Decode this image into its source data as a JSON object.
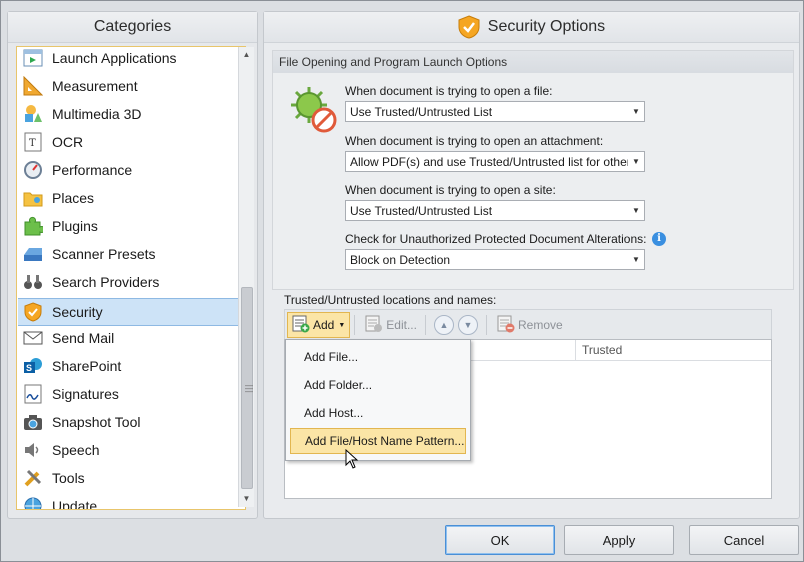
{
  "left_panel": {
    "title": "Categories",
    "items": [
      {
        "label": "Launch Applications",
        "icon": "launch-app-icon"
      },
      {
        "label": "Measurement",
        "icon": "ruler-icon"
      },
      {
        "label": "Multimedia 3D",
        "icon": "shapes-3d-icon"
      },
      {
        "label": "OCR",
        "icon": "ocr-icon"
      },
      {
        "label": "Performance",
        "icon": "gauge-icon"
      },
      {
        "label": "Places",
        "icon": "folder-icon"
      },
      {
        "label": "Plugins",
        "icon": "puzzle-icon"
      },
      {
        "label": "Scanner Presets",
        "icon": "scanner-icon"
      },
      {
        "label": "Search Providers",
        "icon": "binoculars-icon"
      },
      {
        "label": "Security",
        "icon": "shield-icon",
        "selected": true
      },
      {
        "label": "Send Mail",
        "icon": "mail-icon"
      },
      {
        "label": "SharePoint",
        "icon": "sharepoint-icon"
      },
      {
        "label": "Signatures",
        "icon": "signature-icon"
      },
      {
        "label": "Snapshot Tool",
        "icon": "camera-icon"
      },
      {
        "label": "Speech",
        "icon": "speaker-icon"
      },
      {
        "label": "Tools",
        "icon": "tools-icon"
      },
      {
        "label": "Update",
        "icon": "globe-icon"
      }
    ]
  },
  "right_panel": {
    "title": "Security Options",
    "group_title": "File Opening and Program Launch Options",
    "fields": [
      {
        "label": "When document is trying to open a file:",
        "value": "Use Trusted/Untrusted List"
      },
      {
        "label": "When document is trying to open an attachment:",
        "value": "Allow PDF(s) and use Trusted/Untrusted list for other"
      },
      {
        "label": "When document is trying to open a site:",
        "value": "Use Trusted/Untrusted List"
      },
      {
        "label": "Check for Unauthorized Protected Document Alterations:",
        "value": "Block on Detection"
      }
    ],
    "info_glyph": "i",
    "trusted_label": "Trusted/Untrusted locations and names:",
    "toolbar": {
      "add": "Add",
      "edit": "Edit...",
      "remove": "Remove"
    },
    "grid_columns": [
      "Trusted"
    ]
  },
  "menu": {
    "items": [
      "Add File...",
      "Add Folder...",
      "Add Host...",
      "Add File/Host Name Pattern..."
    ]
  },
  "buttons": {
    "ok": "OK",
    "apply": "Apply",
    "cancel": "Cancel"
  },
  "colors": {
    "accent_yellow": "#fbe5a6",
    "selection_blue": "#cde3f7",
    "shield_orange": "#f5a623"
  }
}
